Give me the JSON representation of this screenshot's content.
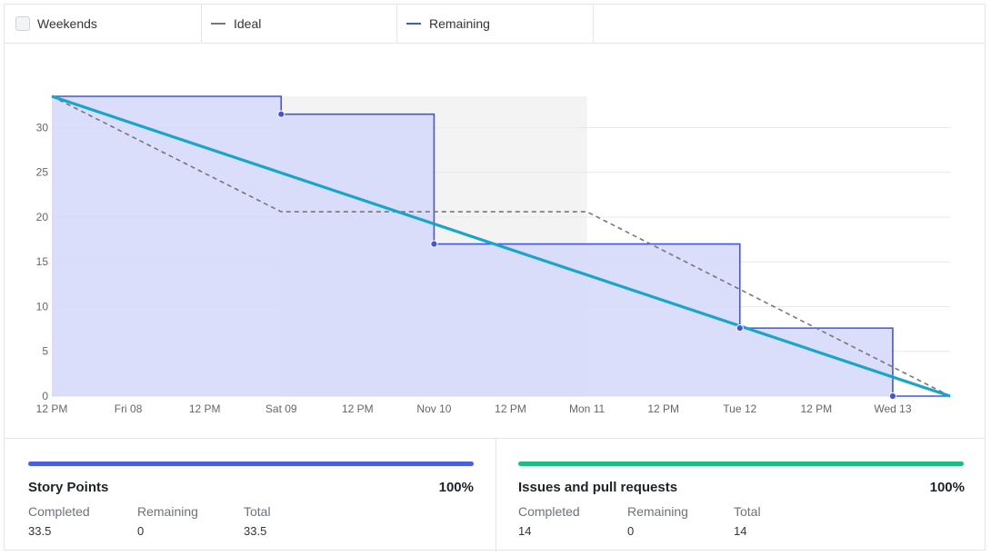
{
  "legend": {
    "weekends_label": "Weekends",
    "ideal_label": "Ideal",
    "remaining_label": "Remaining"
  },
  "colors": {
    "ideal": "#777777",
    "remaining": "#4456d6",
    "remaining_fill": "#d3d8fa",
    "trend": "#1aa5c8",
    "weekend_shade": "#f3f3f3",
    "story_points_bar": "#4a5ee0",
    "issues_bar": "#1dbd82"
  },
  "chart_data": {
    "type": "line",
    "x_tick_labels": [
      "12 PM",
      "Fri 08",
      "12 PM",
      "Sat 09",
      "12 PM",
      "Nov 10",
      "12 PM",
      "Mon 11",
      "12 PM",
      "Tue 12",
      "12 PM",
      "Wed 13"
    ],
    "x_tick_hours": [
      0,
      12,
      24,
      36,
      48,
      60,
      72,
      84,
      96,
      108,
      120,
      132
    ],
    "xlim_hours": [
      0,
      141
    ],
    "ylim": [
      0,
      33.5
    ],
    "y_ticks": [
      0,
      5,
      10,
      15,
      20,
      25,
      30
    ],
    "grid": true,
    "weekend_span_hours": [
      36,
      84
    ],
    "series": [
      {
        "name": "Ideal",
        "style": "dashed",
        "points": [
          [
            0,
            33.5
          ],
          [
            36,
            20.6
          ],
          [
            84,
            20.6
          ],
          [
            141,
            0
          ]
        ]
      },
      {
        "name": "Remaining",
        "style": "step",
        "points": [
          [
            0,
            33.5
          ],
          [
            36,
            31.5
          ],
          [
            60,
            17
          ],
          [
            108,
            7.6
          ],
          [
            132,
            0
          ],
          [
            141,
            0
          ]
        ]
      },
      {
        "style": "trend",
        "points": [
          [
            0,
            33.5
          ],
          [
            141,
            0
          ]
        ]
      }
    ]
  },
  "story_points": {
    "title": "Story Points",
    "percent": "100%",
    "progress": 1.0,
    "completed_label": "Completed",
    "completed_value": "33.5",
    "remaining_label": "Remaining",
    "remaining_value": "0",
    "total_label": "Total",
    "total_value": "33.5"
  },
  "issues": {
    "title": "Issues and pull requests",
    "percent": "100%",
    "progress": 1.0,
    "completed_label": "Completed",
    "completed_value": "14",
    "remaining_label": "Remaining",
    "remaining_value": "0",
    "total_label": "Total",
    "total_value": "14"
  }
}
